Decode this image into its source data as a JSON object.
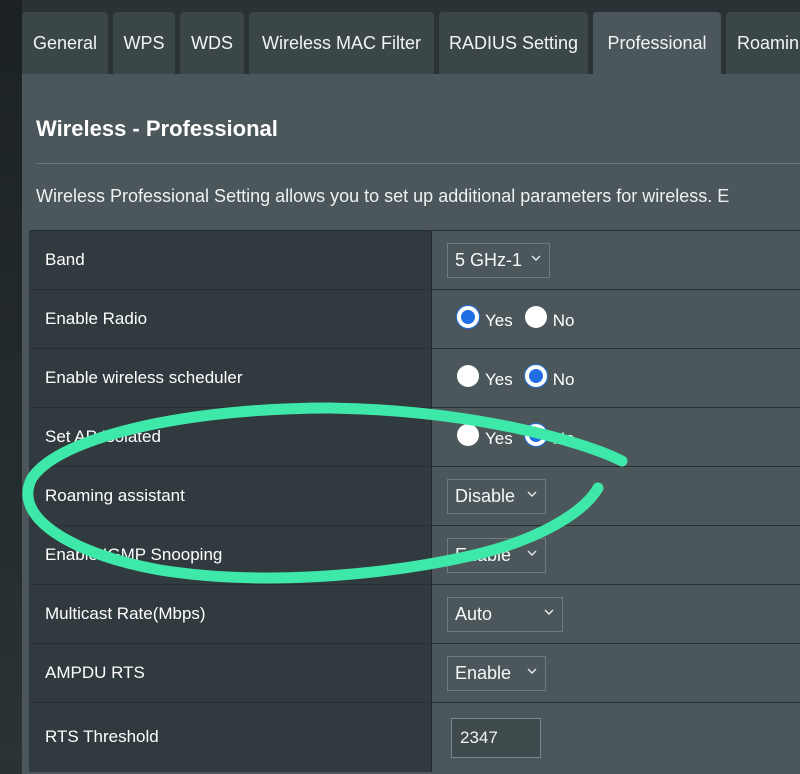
{
  "tabs": [
    {
      "label": "General",
      "active": false
    },
    {
      "label": "WPS",
      "active": false
    },
    {
      "label": "WDS",
      "active": false
    },
    {
      "label": "Wireless MAC Filter",
      "active": false
    },
    {
      "label": "RADIUS Setting",
      "active": false
    },
    {
      "label": "Professional",
      "active": true
    },
    {
      "label": "Roamin",
      "active": false
    }
  ],
  "page": {
    "title": "Wireless - Professional",
    "description": "Wireless Professional Setting allows you to set up additional parameters for wireless. E"
  },
  "settings": [
    {
      "label": "Band",
      "type": "select",
      "value": "5 GHz-1"
    },
    {
      "label": "Enable Radio",
      "type": "radio",
      "options": [
        "Yes",
        "No"
      ],
      "selected": "Yes"
    },
    {
      "label": "Enable wireless scheduler",
      "type": "radio",
      "options": [
        "Yes",
        "No"
      ],
      "selected": "No"
    },
    {
      "label": "Set AP Isolated",
      "type": "radio",
      "options": [
        "Yes",
        "No"
      ],
      "selected": "No"
    },
    {
      "label": "Roaming assistant",
      "type": "select",
      "value": "Disable"
    },
    {
      "label": "Enable IGMP Snooping",
      "type": "select",
      "value": "Enable"
    },
    {
      "label": "Multicast Rate(Mbps)",
      "type": "select",
      "value": "Auto"
    },
    {
      "label": "AMPDU RTS",
      "type": "select",
      "value": "Enable"
    },
    {
      "label": "RTS Threshold",
      "type": "text",
      "value": "2347"
    }
  ],
  "colors": {
    "accent": "#1f6fe5",
    "annotation": "#3ee8a8",
    "panel": "#4b575a",
    "label_column": "#313a3e"
  },
  "icons": {
    "dropdown": "chevron-down-icon",
    "annotation": "freehand-highlight-ellipse"
  }
}
